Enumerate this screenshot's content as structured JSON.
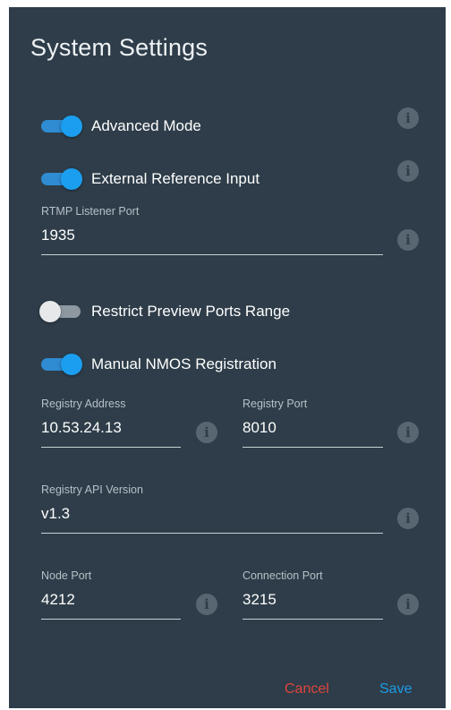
{
  "dialog": {
    "title": "System Settings"
  },
  "toggles": {
    "advanced_mode": {
      "label": "Advanced Mode",
      "on": true
    },
    "external_reference": {
      "label": "External Reference Input",
      "on": true
    },
    "restrict_preview": {
      "label": "Restrict Preview Ports Range",
      "on": false
    },
    "manual_nmos": {
      "label": "Manual NMOS Registration",
      "on": true
    }
  },
  "fields": {
    "rtmp_port": {
      "label": "RTMP Listener Port",
      "value": "1935"
    },
    "registry_address": {
      "label": "Registry Address",
      "value": "10.53.24.13"
    },
    "registry_port": {
      "label": "Registry Port",
      "value": "8010"
    },
    "registry_api_version": {
      "label": "Registry API Version",
      "value": "v1.3"
    },
    "node_port": {
      "label": "Node Port",
      "value": "4212"
    },
    "connection_port": {
      "label": "Connection Port",
      "value": "3215"
    }
  },
  "actions": {
    "cancel_label": "Cancel",
    "save_label": "Save"
  },
  "icons": {
    "info": "info-icon",
    "info_glyph": "i"
  },
  "colors": {
    "background": "#2e3d49",
    "accent": "#1b9ef0",
    "cancel": "#e0443b",
    "save": "#1e9be6"
  }
}
